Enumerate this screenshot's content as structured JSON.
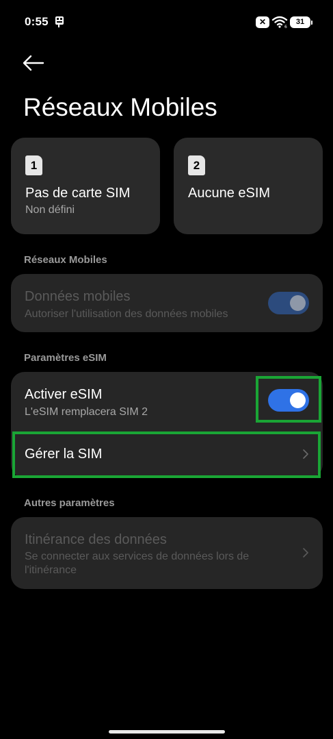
{
  "status_bar": {
    "time": "0:55",
    "battery": "31"
  },
  "page": {
    "title": "Réseaux Mobiles"
  },
  "sim_cards": [
    {
      "number": "1",
      "title": "Pas de carte SIM",
      "subtitle": "Non défini"
    },
    {
      "number": "2",
      "title": "Aucune eSIM",
      "subtitle": ""
    }
  ],
  "sections": {
    "mobile_networks": {
      "label": "Réseaux Mobiles",
      "mobile_data": {
        "title": "Données mobiles",
        "subtitle": "Autoriser l'utilisation des données mobiles",
        "enabled": true,
        "disabled_state": true
      }
    },
    "esim_settings": {
      "label": "Paramètres eSIM",
      "activate_esim": {
        "title": "Activer eSIM",
        "subtitle": "L'eSIM remplacera SIM 2",
        "enabled": true
      },
      "manage_sim": {
        "title": "Gérer la SIM"
      }
    },
    "other_settings": {
      "label": "Autres paramètres",
      "data_roaming": {
        "title": "Itinérance des données",
        "subtitle": "Se connecter aux services de données lors de l'itinérance"
      }
    }
  },
  "colors": {
    "accent": "#2f72e6",
    "highlight": "#1aa535",
    "card": "#262626"
  }
}
